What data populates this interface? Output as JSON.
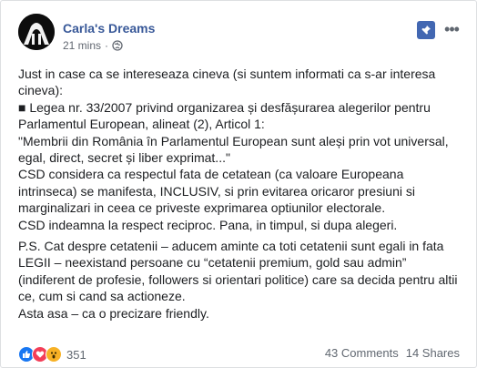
{
  "post": {
    "author": "Carla's Dreams",
    "time": "21 mins",
    "separator": "·",
    "paragraphs": [
      [
        "Just in case ca se intereseaza cineva (si suntem informati ca s-ar interesa cineva):",
        "■ Legea nr. 33/2007 privind organizarea și desfășurarea alegerilor pentru Parlamentul European, alineat (2), Articol 1:",
        "\"Membrii din România în Parlamentul European sunt aleși prin vot universal, egal, direct, secret și liber exprimat...\"",
        "CSD considera ca respectul fata de cetatean (ca valoare Europeana intrinseca) se manifesta, INCLUSIV, si prin evitarea oricaror presiuni si marginalizari in ceea ce priveste exprimarea optiunilor electorale.",
        "CSD indeamna la respect reciproc. Pana, in timpul, si dupa alegeri."
      ],
      [
        "P.S. Cat despre cetatenii – aducem aminte ca toti cetatenii sunt egali in fata LEGII – neexistand persoane cu “cetatenii premium, gold sau admin” (indiferent de profesie, followers si orientari politice) care sa decida pentru altii ce, cum si cand sa actioneze.",
        "Asta asa – ca o precizare friendly."
      ]
    ]
  },
  "footer": {
    "reaction_count": "351",
    "comments": "43 Comments",
    "shares": "14 Shares"
  },
  "colors": {
    "author": "#385898",
    "pin_bg": "#4267b2",
    "like": "#1877f2",
    "love": "#f33e58",
    "wow": "#f7b125"
  },
  "icons": [
    "globe-icon",
    "pin-icon",
    "more-icon",
    "like-reaction-icon",
    "love-reaction-icon",
    "wow-reaction-icon"
  ]
}
